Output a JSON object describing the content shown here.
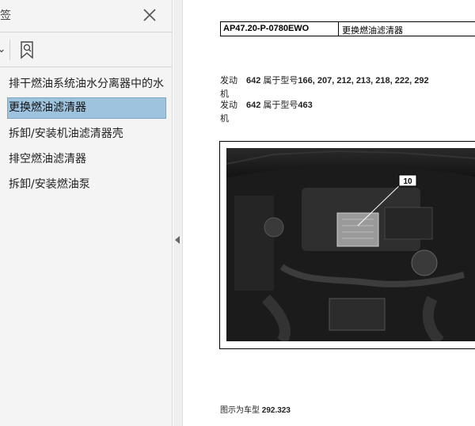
{
  "sidebar": {
    "title": "签",
    "items": [
      {
        "label": "排干燃油系统油水分离器中的水"
      },
      {
        "label": "更换燃油滤清器",
        "selected": true
      },
      {
        "label": "拆卸/安装机油滤清器壳"
      },
      {
        "label": "排空燃油滤清器"
      },
      {
        "label": "拆卸/安装燃油泵"
      }
    ]
  },
  "document": {
    "header": {
      "code": "AP47.20-P-0780EWO",
      "title": "更换燃油滤清器"
    },
    "engines": [
      {
        "label": "发动机",
        "model": "642",
        "text": "属于型号",
        "types": "166, 207, 212, 213, 218, 222, 292"
      },
      {
        "label": "发动机",
        "model": "642",
        "text": "属于型号",
        "types": "463"
      }
    ],
    "figure_callout": "10",
    "caption": {
      "text": "图示为车型",
      "model": "292.323"
    }
  },
  "colors": {
    "selection": "#9dc3de",
    "sidebar_bg": "#f4f4f4"
  }
}
